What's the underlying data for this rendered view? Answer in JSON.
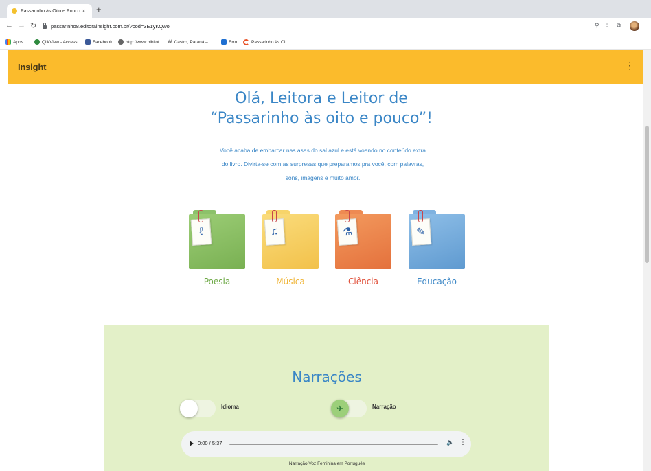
{
  "browser": {
    "tab_title": "Passarinho às Oito e Pouco",
    "tab_close": "×",
    "new_tab": "+",
    "url": "passarinho8.editorainsight.com.br/?cod=3E1yKQwo",
    "bookmarks": [
      "Apps",
      "QlikView - Access...",
      "Facebook",
      "http://www.bibliot...",
      "Castro, Paraná –...",
      "Erro",
      "Passarinho às Oit..."
    ]
  },
  "site": {
    "logo": "Insight",
    "menu": "⋮"
  },
  "hero": {
    "title_line1": "Olá, Leitora e Leitor de",
    "title_line2": "“Passarinho às oito e pouco”!",
    "intro_line1": "Você acaba de embarcar nas asas do sal azul e está voando no conteúdo extra",
    "intro_line2": "do livro. Divirta-se com as surpresas que preparamos pra você, com palavras,",
    "intro_line3": "sons, imagens e muito amor."
  },
  "categories": [
    {
      "label": "Poesia",
      "color": "#6ca844",
      "folder_color": "#8cc16a",
      "icon": "poetry-icon"
    },
    {
      "label": "Música",
      "color": "#f0b63a",
      "folder_color": "#f7d46a",
      "icon": "music-icon"
    },
    {
      "label": "Ciência",
      "color": "#e0503a",
      "folder_color": "#ee8a52",
      "icon": "microscope-icon"
    },
    {
      "label": "Educação",
      "color": "#3a86c6",
      "folder_color": "#7fb2e0",
      "icon": "education-icon"
    }
  ],
  "narrations": {
    "title": "Narrações",
    "toggle_language": "Idioma",
    "toggle_narration": "Narração",
    "player_time": "0:00 / 5:37",
    "caption": "Narração Voz Feminina em Português"
  }
}
